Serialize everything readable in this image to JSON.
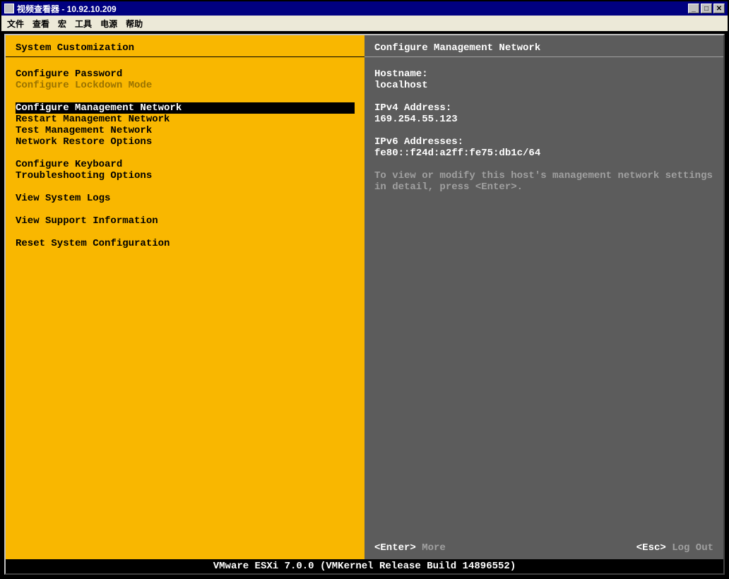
{
  "titlebar": {
    "title": "视频查看器 - 10.92.10.209"
  },
  "menubar": {
    "file": "文件",
    "view": "查看",
    "macro": "宏",
    "tools": "工具",
    "power": "电源",
    "help": "帮助"
  },
  "left_panel": {
    "header": "System Customization",
    "items": [
      {
        "label": "Configure Password",
        "type": "item"
      },
      {
        "label": "Configure Lockdown Mode",
        "type": "disabled"
      },
      {
        "label": "",
        "type": "spacer"
      },
      {
        "label": "Configure Management Network",
        "type": "selected"
      },
      {
        "label": "Restart Management Network",
        "type": "item"
      },
      {
        "label": "Test Management Network",
        "type": "item"
      },
      {
        "label": "Network Restore Options",
        "type": "item"
      },
      {
        "label": "",
        "type": "spacer"
      },
      {
        "label": "Configure Keyboard",
        "type": "item"
      },
      {
        "label": "Troubleshooting Options",
        "type": "item"
      },
      {
        "label": "",
        "type": "spacer"
      },
      {
        "label": "View System Logs",
        "type": "item"
      },
      {
        "label": "",
        "type": "spacer"
      },
      {
        "label": "View Support Information",
        "type": "item"
      },
      {
        "label": "",
        "type": "spacer"
      },
      {
        "label": "Reset System Configuration",
        "type": "item"
      }
    ]
  },
  "right_panel": {
    "header": "Configure Management Network",
    "hostname_label": "Hostname:",
    "hostname_value": "localhost",
    "ipv4_label": "IPv4 Address:",
    "ipv4_value": "169.254.55.123",
    "ipv6_label": "IPv6 Addresses:",
    "ipv6_value": "fe80::f24d:a2ff:fe75:db1c/64",
    "hint": "To view or modify this host's management network settings in detail, press <Enter>.",
    "enter_key": "<Enter>",
    "enter_label": "More",
    "esc_key": "<Esc>",
    "esc_label": "Log Out"
  },
  "version": "VMware ESXi 7.0.0 (VMKernel Release Build 14896552)"
}
